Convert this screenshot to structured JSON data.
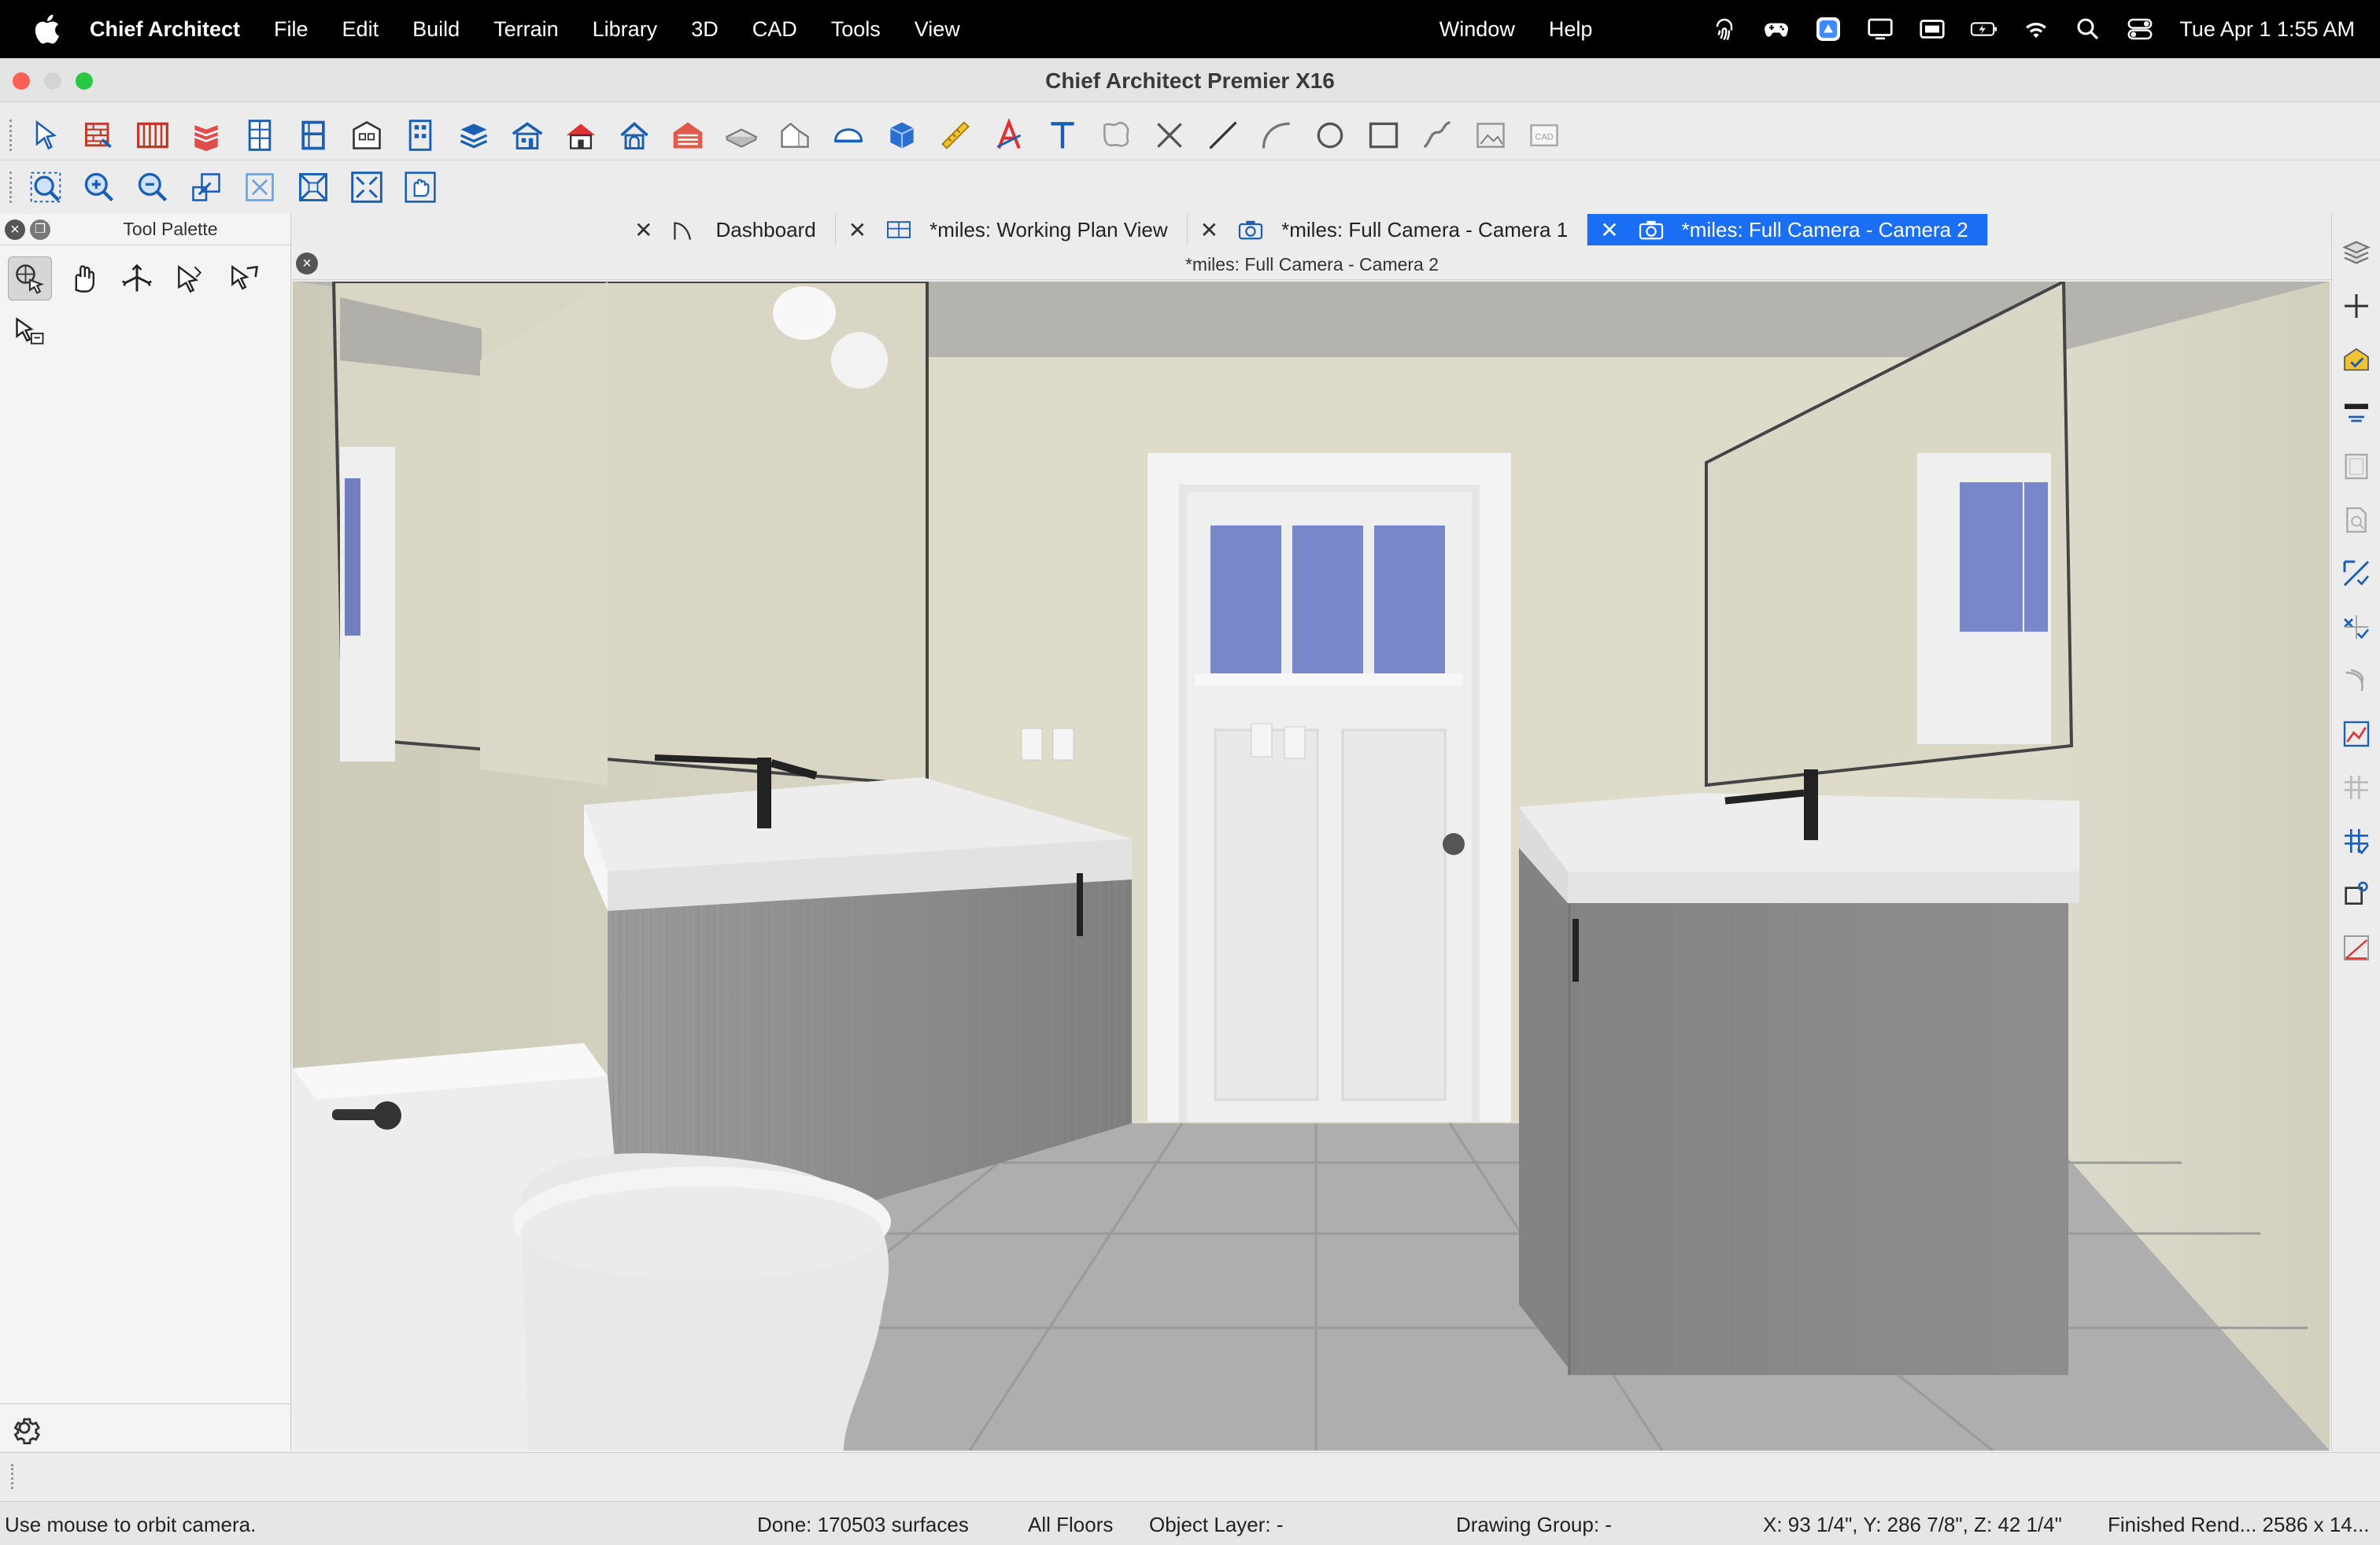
{
  "menubar": {
    "app_name": "Chief Architect",
    "items": [
      "File",
      "Edit",
      "Build",
      "Terrain",
      "Library",
      "3D",
      "CAD",
      "Tools",
      "View"
    ],
    "right_items": [
      "Window",
      "Help"
    ],
    "clock": "Tue Apr 1  1:55 AM",
    "tray_icons": [
      "fingerprint-icon",
      "gamepad-icon",
      "app-icon",
      "display-icon",
      "window-icon",
      "battery-icon",
      "wifi-icon",
      "search-icon",
      "control-center-icon"
    ]
  },
  "window": {
    "title": "Chief Architect Premier X16"
  },
  "toolbar_row1": {
    "icons": [
      "select-objects-icon",
      "wall-tool-icon",
      "railing-icon",
      "stairs-icon",
      "cabinet-icon",
      "door-icon",
      "window-icon",
      "building-icon",
      "floor-icon",
      "house-icon",
      "roof-icon",
      "dormer-icon",
      "garage-icon",
      "slab-icon",
      "ceiling-icon",
      "shelf-icon",
      "box-3d-icon",
      "dimension-icon",
      "text-style-icon",
      "text-icon",
      "callout-icon",
      "x-line-icon",
      "line-icon",
      "arc-icon",
      "circle-icon",
      "rectangle-icon",
      "spline-icon",
      "picture-icon",
      "cad-block-icon"
    ]
  },
  "toolbar_row2": {
    "icons": [
      "zoom-window-icon",
      "zoom-in-icon",
      "zoom-out-icon",
      "undo-zoom-icon",
      "fill-window-icon",
      "fill-building-icon",
      "fit-screen-icon",
      "pan-icon"
    ]
  },
  "palette": {
    "title": "Tool Palette",
    "tools": [
      "orbit-camera-tool-icon",
      "pan-hand-tool-icon",
      "move-camera-tool-icon",
      "tilt-camera-tool-icon",
      "pivot-camera-tool-icon",
      "spin-camera-tool-icon"
    ]
  },
  "tabs": [
    {
      "label": "Dashboard",
      "icon": "dashboard-icon",
      "active": false
    },
    {
      "label": "*miles:  Working Plan View",
      "icon": "plan-view-icon",
      "active": false
    },
    {
      "label": "*miles: Full Camera - Camera 1",
      "icon": "camera-icon",
      "active": false
    },
    {
      "label": "*miles: Full Camera - Camera 2",
      "icon": "camera-icon",
      "active": true
    }
  ],
  "view": {
    "title": "*miles: Full Camera - Camera 2"
  },
  "right_toolbar": {
    "icons": [
      "layers-icon",
      "add-icon",
      "material-icon",
      "level-icon",
      "panel-icon",
      "page-search-icon",
      "dimension-check-icon",
      "grid-check-icon",
      "curve-icon",
      "chart-icon",
      "grid-icon",
      "snap-grid-icon",
      "node-icon",
      "angle-icon"
    ]
  },
  "status": {
    "hint": "Use mouse to orbit camera.",
    "done": "Done:  170503 surfaces",
    "floors": "All Floors",
    "object_layer": "Object Layer: -",
    "drawing_group": "Drawing Group: -",
    "coordinates": "X: 93 1/4\", Y: 286 7/8\", Z: 42 1/4\"",
    "render": "Finished Rend...  2586 x 14..."
  },
  "colors": {
    "active_tab": "#1b6ff5",
    "wall": "#d7d4c4",
    "cabinet": "#8d8d8d",
    "floor_tile": "#a9a9a9",
    "door": "#f1f1f1",
    "window_glass": "#7383c8"
  }
}
